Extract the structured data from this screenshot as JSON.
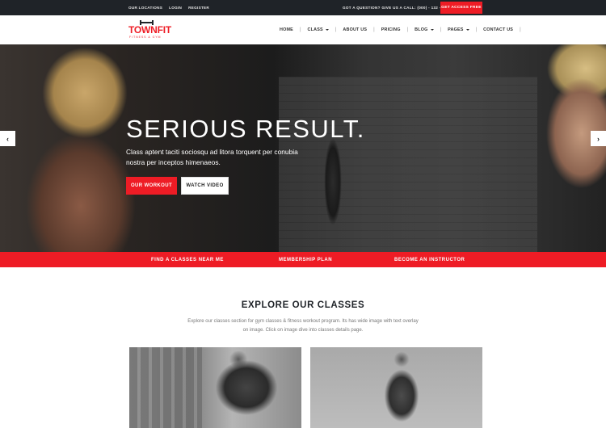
{
  "topbar": {
    "links": [
      "OUR LOCATIONS",
      "LOGIN",
      "REGISTER"
    ],
    "call_text": "GOT A QUESTION? GIVE US A CALL: (000) - 132 - 4567",
    "cta_label": "GET ACCESS FREE"
  },
  "header": {
    "logo_name": "TOWNFIT",
    "logo_tagline": "FITNESS & GYM",
    "nav": [
      {
        "label": "HOME",
        "dropdown": false
      },
      {
        "label": "CLASS",
        "dropdown": true
      },
      {
        "label": "ABOUT US",
        "dropdown": false
      },
      {
        "label": "PRICING",
        "dropdown": false
      },
      {
        "label": "BLOG",
        "dropdown": true
      },
      {
        "label": "PAGES",
        "dropdown": true
      },
      {
        "label": "CONTACT US",
        "dropdown": false
      }
    ],
    "separator": "|"
  },
  "hero": {
    "title": "SERIOUS RESULT.",
    "text": "Class aptent taciti sociosqu ad litora torquent per conubia nostra per inceptos himenaeos.",
    "primary_button": "OUR WORKOUT",
    "secondary_button": "WATCH VIDEO",
    "prev_glyph": "‹",
    "next_glyph": "›"
  },
  "strip": {
    "items": [
      "FIND A CLASSES NEAR ME",
      "MEMBERSHIP PLAN",
      "BECOME AN INSTRUCTOR"
    ]
  },
  "explore": {
    "title": "EXPLORE OUR CLASSES",
    "description": "Explore our classes section for gym classes & fitness workout program. Its has wide image with text overlay on image. Click on image dive into classes details page."
  },
  "colors": {
    "accent": "#ee1c25",
    "dark": "#1f2328"
  }
}
